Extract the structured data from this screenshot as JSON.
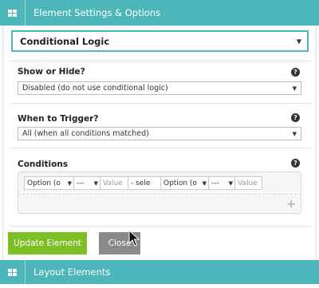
{
  "header": {
    "title": "Element Settings & Options",
    "icon": "grid-icon",
    "color": "#4db6ba"
  },
  "main_select": {
    "value": "Conditional Logic"
  },
  "show_hide": {
    "label": "Show or Hide?",
    "value": "Disabled (do not use conditional logic)"
  },
  "trigger": {
    "label": "When to Trigger?",
    "value": "All (when all conditions matched)"
  },
  "conditions": {
    "label": "Conditions",
    "row": [
      {
        "text": "Option (o",
        "type": "select"
      },
      {
        "text": "---",
        "type": "select"
      },
      {
        "text": "Value",
        "type": "input"
      },
      {
        "text": "- sele",
        "type": "select"
      },
      {
        "text": "Option (o",
        "type": "select"
      },
      {
        "text": "---",
        "type": "select"
      },
      {
        "text": "Value",
        "type": "input"
      }
    ]
  },
  "buttons": {
    "update": "Update Element",
    "close": "Close"
  },
  "footer": {
    "title": "Layout Elements",
    "icon": "grid-icon"
  },
  "colors": {
    "accent": "#4db6ba",
    "update_button": "#7fbf26",
    "close_button": "#8a8a8a"
  }
}
